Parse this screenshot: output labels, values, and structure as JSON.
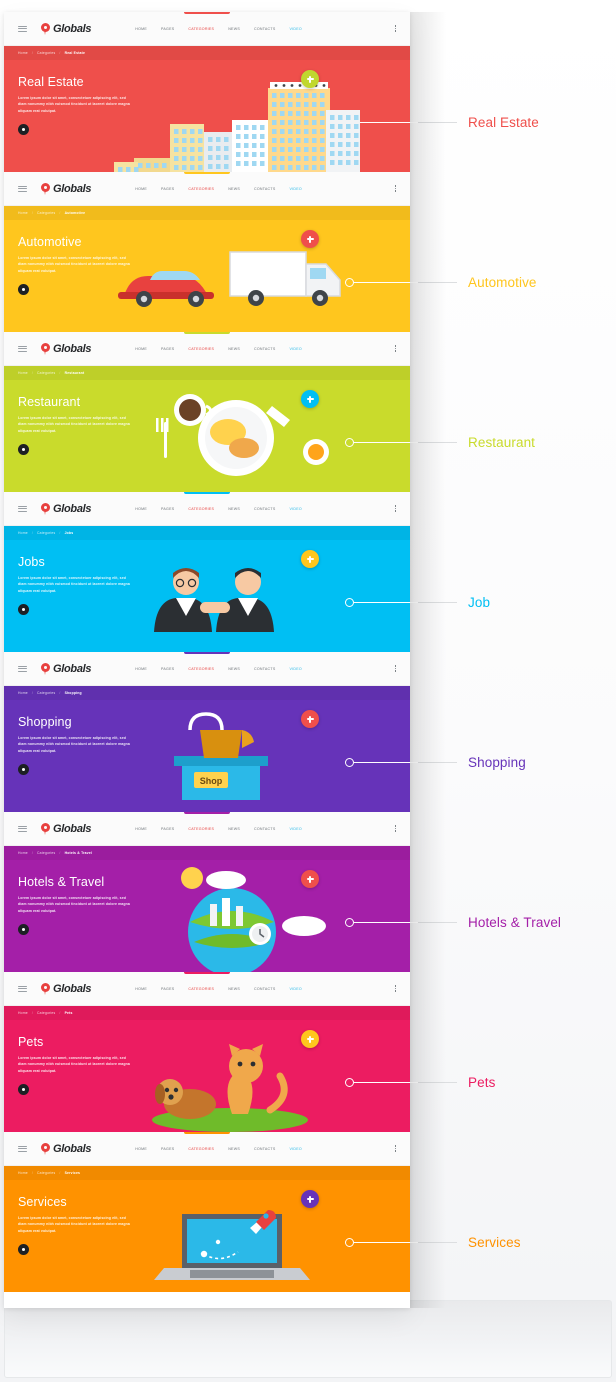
{
  "nav": {
    "brand": "Globals",
    "menu": [
      "Home",
      "Pages",
      "Categories",
      "News",
      "Contacts",
      "Video"
    ],
    "active_index": 2,
    "highlight_index": 5,
    "menu_icon": "hamburger-icon",
    "overflow_icon": "kebab-menu-icon",
    "brand_icon": "map-pin-icon"
  },
  "breadcrumb": {
    "home": "Home",
    "section": "Categories",
    "separator": "/"
  },
  "hero": {
    "description": "Lorem ipsum dolor sit amet, consectetuer adipiscing elit, sed diam nonummy nibh euismod tincidunt ut laoreet dolore magna aliquam erat volutpat."
  },
  "sections": [
    {
      "id": "real-estate",
      "title": "Real Estate",
      "crumb": "Real Estate",
      "label": "Real Estate",
      "color": "#ef4f4b",
      "accent": "#ef4f4b",
      "label_color": "#ef4f4b",
      "fab_color": "#c0d72f",
      "art": "city-buildings"
    },
    {
      "id": "automotive",
      "title": "Automotive",
      "crumb": "Automotive",
      "label": "Automotive",
      "color": "#ffc61e",
      "accent": "#ffc61e",
      "label_color": "#ffc61e",
      "fab_color": "#ef4f4b",
      "art": "car-truck"
    },
    {
      "id": "restaurant",
      "title": "Restaurant",
      "crumb": "Restaurant",
      "label": "Restaurant",
      "color": "#c9db2c",
      "accent": "#c9db2c",
      "label_color": "#c9db2c",
      "fab_color": "#00bff3",
      "art": "food-plate"
    },
    {
      "id": "jobs",
      "title": "Jobs",
      "crumb": "Jobs",
      "label": "Job",
      "color": "#00bff3",
      "accent": "#00bff3",
      "label_color": "#00bff3",
      "fab_color": "#ffc61e",
      "art": "businessmen-handshake"
    },
    {
      "id": "shopping",
      "title": "Shopping",
      "crumb": "Shopping",
      "label": "Shopping",
      "color": "#6633b9",
      "accent": "#6633b9",
      "label_color": "#6633b9",
      "fab_color": "#ef4f4b",
      "art": "shop-front"
    },
    {
      "id": "hotels-travel",
      "title": "Hotels & Travel",
      "crumb": "Hotels & Travel",
      "label": "Hotels & Travel",
      "color": "#a41fa8",
      "accent": "#a41fa8",
      "label_color": "#a41fa8",
      "fab_color": "#ef4f4b",
      "art": "travel-globe"
    },
    {
      "id": "pets",
      "title": "Pets",
      "crumb": "Pets",
      "label": "Pets",
      "color": "#ec1c61",
      "accent": "#ec1c61",
      "label_color": "#ec1c61",
      "fab_color": "#ffc61e",
      "art": "cat-dog"
    },
    {
      "id": "services",
      "title": "Services",
      "crumb": "Services",
      "label": "Services",
      "color": "#ff9200",
      "accent": "#ff9200",
      "label_color": "#ff9200",
      "fab_color": "#6633b9",
      "art": "laptop-rocket"
    }
  ]
}
